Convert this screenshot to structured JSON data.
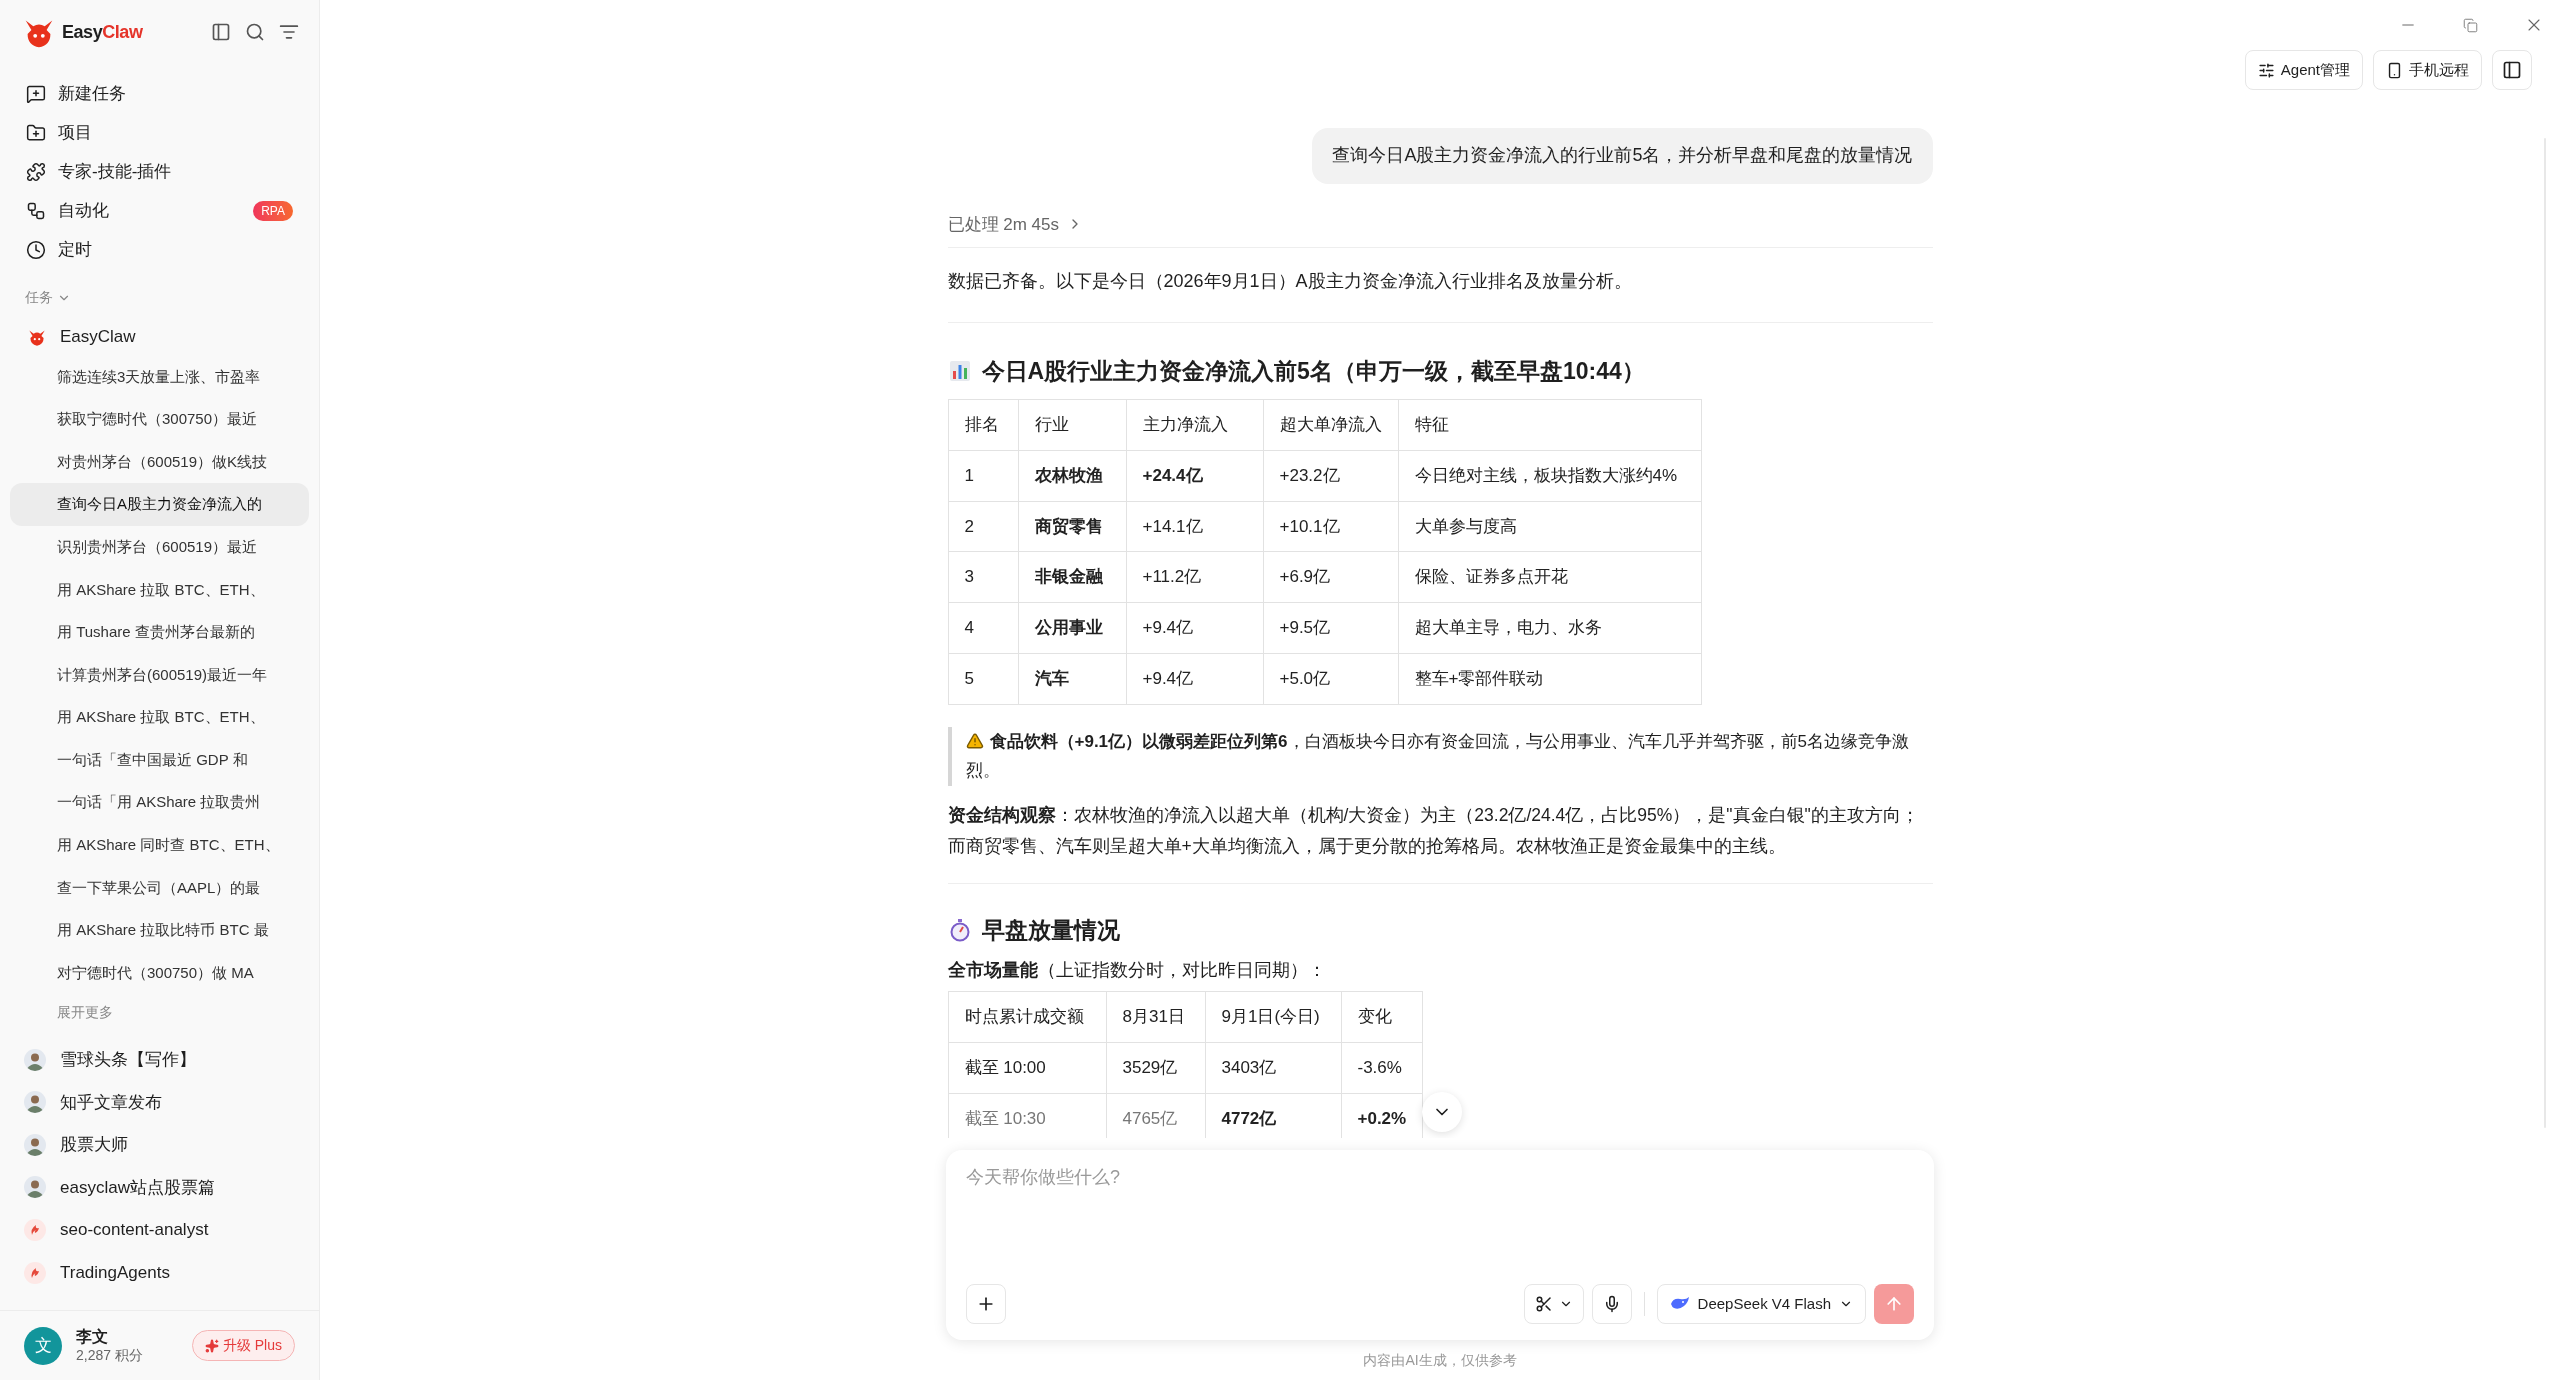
{
  "sidebar": {
    "brand": {
      "part1": "Easy",
      "part2": "Claw"
    },
    "nav": [
      {
        "kind": "new",
        "label": "新建任务"
      },
      {
        "kind": "project",
        "label": "项目"
      },
      {
        "kind": "plugin",
        "label": "专家-技能-插件"
      },
      {
        "kind": "auto",
        "label": "自动化",
        "badge": "RPA"
      },
      {
        "kind": "timer",
        "label": "定时"
      }
    ],
    "section_label": "任务",
    "group": {
      "label": "EasyClaw",
      "tasks": [
        {
          "label": "筛选连续3天放量上涨、市盈率",
          "selected": false
        },
        {
          "label": "获取宁德时代（300750）最近",
          "selected": false
        },
        {
          "label": "对贵州茅台（600519）做K线技",
          "selected": false
        },
        {
          "label": "查询今日A股主力资金净流入的",
          "selected": true
        },
        {
          "label": "识别贵州茅台（600519）最近",
          "selected": false
        },
        {
          "label": "用 AKShare 拉取 BTC、ETH、",
          "selected": false
        },
        {
          "label": "用 Tushare 查贵州茅台最新的",
          "selected": false
        },
        {
          "label": "计算贵州茅台(600519)最近一年",
          "selected": false
        },
        {
          "label": "用 AKShare 拉取 BTC、ETH、",
          "selected": false
        },
        {
          "label": "一句话「查中国最近 GDP 和",
          "selected": false
        },
        {
          "label": "一句话「用 AKShare 拉取贵州",
          "selected": false
        },
        {
          "label": "用 AKShare 同时查 BTC、ETH、",
          "selected": false
        },
        {
          "label": "查一下苹果公司（AAPL）的最",
          "selected": false
        },
        {
          "label": "用 AKShare 拉取比特币 BTC 最",
          "selected": false
        },
        {
          "label": "对宁德时代（300750）做 MA",
          "selected": false
        }
      ],
      "more": "展开更多"
    },
    "agents": [
      {
        "kind": "person",
        "label": "雪球头条【写作】"
      },
      {
        "kind": "person",
        "label": "知乎文章发布"
      },
      {
        "kind": "person",
        "label": "股票大师"
      },
      {
        "kind": "person",
        "label": "easyclaw站点股票篇"
      },
      {
        "kind": "skill",
        "label": "seo-content-analyst"
      },
      {
        "kind": "skill",
        "label": "TradingAgents"
      }
    ],
    "user": {
      "avatar": "文",
      "name": "李文",
      "points": "2,287 积分",
      "upgrade": "升级 Plus"
    }
  },
  "toolbar": {
    "buttons": [
      {
        "kind": "agent",
        "label": "Agent管理"
      },
      {
        "kind": "phone",
        "label": "手机远程"
      },
      {
        "kind": "panel"
      }
    ]
  },
  "chat": {
    "user_message": "查询今日A股主力资金净流入的行业前5名，并分析早盘和尾盘的放量情况",
    "processed": "已处理 2m 45s",
    "intro": "数据已齐备。以下是今日（2026年9月1日）A股主力资金净流入行业排名及放量分析。",
    "heading1": {
      "kind": "chart",
      "text": "今日A股行业主力资金净流入前5名（申万一级，截至早盘10:44）"
    },
    "table1": {
      "columns": [
        "排名",
        "行业",
        "主力净流入",
        "超大单净流入",
        "特征"
      ],
      "rows": [
        [
          {
            "text": "1",
            "bold": false
          },
          {
            "text": "农林牧渔",
            "bold": true
          },
          {
            "text": "+24.4亿",
            "bold": true
          },
          {
            "text": "+23.2亿",
            "bold": false
          },
          {
            "text": "今日绝对主线，板块指数大涨约4%",
            "bold": false
          }
        ],
        [
          {
            "text": "2",
            "bold": false
          },
          {
            "text": "商贸零售",
            "bold": true
          },
          {
            "text": "+14.1亿",
            "bold": false
          },
          {
            "text": "+10.1亿",
            "bold": false
          },
          {
            "text": "大单参与度高",
            "bold": false
          }
        ],
        [
          {
            "text": "3",
            "bold": false
          },
          {
            "text": "非银金融",
            "bold": true
          },
          {
            "text": "+11.2亿",
            "bold": false
          },
          {
            "text": "+6.9亿",
            "bold": false
          },
          {
            "text": "保险、证券多点开花",
            "bold": false
          }
        ],
        [
          {
            "text": "4",
            "bold": false
          },
          {
            "text": "公用事业",
            "bold": true
          },
          {
            "text": "+9.4亿",
            "bold": false
          },
          {
            "text": "+9.5亿",
            "bold": false
          },
          {
            "text": "超大单主导，电力、水务",
            "bold": false
          }
        ],
        [
          {
            "text": "5",
            "bold": false
          },
          {
            "text": "汽车",
            "bold": true
          },
          {
            "text": "+9.4亿",
            "bold": false
          },
          {
            "text": "+5.0亿",
            "bold": false
          },
          {
            "text": "整车+零部件联动",
            "bold": false
          }
        ]
      ]
    },
    "note": "**食品饮料（+9.1亿）以微弱差距位列第6**，白酒板块今日亦有资金回流，与公用事业、汽车几乎并驾齐驱，前5名边缘竞争激烈。",
    "observation": "**资金结构观察**：农林牧渔的净流入以超大单（机构/大资金）为主（23.2亿/24.4亿，占比95%），是\"真金白银\"的主攻方向；而商贸零售、汽车则呈超大单+大单均衡流入，属于更分散的抢筹格局。农林牧渔正是资金最集中的主线。",
    "heading2": {
      "kind": "stopwatch",
      "text": "早盘放量情况"
    },
    "subtitle": "**全市场量能**（上证指数分时，对比昨日同期）：",
    "table2": {
      "columns": [
        "时点累计成交额",
        "8月31日",
        "9月1日(今日)",
        "变化"
      ],
      "rows": [
        [
          {
            "text": "截至 10:00",
            "bold": false
          },
          {
            "text": "3529亿",
            "bold": false
          },
          {
            "text": "3403亿",
            "bold": false
          },
          {
            "text": "-3.6%",
            "bold": false
          }
        ],
        [
          {
            "text": "截至 10:30",
            "bold": false
          },
          {
            "text": "4765亿",
            "bold": false
          },
          {
            "text": "4772亿",
            "bold": true
          },
          {
            "text": "+0.2%",
            "bold": true
          }
        ]
      ]
    }
  },
  "composer": {
    "placeholder": "今天帮你做些什么?",
    "model": "DeepSeek V4 Flash"
  },
  "disclaimer": "内容由AI生成，仅供参考"
}
